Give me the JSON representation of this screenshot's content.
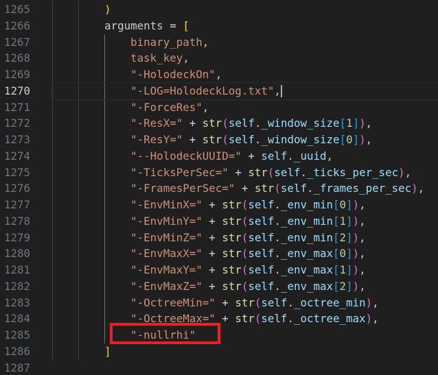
{
  "editor": {
    "lines": [
      {
        "number": "1265",
        "indent": 2,
        "tokens": [
          {
            "t": ")",
            "c": "b1"
          }
        ]
      },
      {
        "number": "1266",
        "indent": 2,
        "tokens": [
          {
            "t": "arguments",
            "c": "ident"
          },
          {
            "t": " = ",
            "c": "op"
          },
          {
            "t": "[",
            "c": "b1"
          }
        ]
      },
      {
        "number": "1267",
        "indent": 3,
        "tokens": [
          {
            "t": "binary_path",
            "c": "string"
          },
          {
            "t": ",",
            "c": "punct"
          }
        ]
      },
      {
        "number": "1268",
        "indent": 3,
        "tokens": [
          {
            "t": "task_key",
            "c": "string"
          },
          {
            "t": ",",
            "c": "punct"
          }
        ]
      },
      {
        "number": "1269",
        "indent": 3,
        "tokens": [
          {
            "t": "\"-HolodeckOn\"",
            "c": "string"
          },
          {
            "t": ",",
            "c": "punct"
          }
        ]
      },
      {
        "number": "1270",
        "indent": 3,
        "current": true,
        "tokens": [
          {
            "t": "\"-LOG=HolodeckLog.txt\"",
            "c": "string"
          },
          {
            "t": ",",
            "c": "punct"
          },
          {
            "t": "",
            "c": "cursor"
          }
        ]
      },
      {
        "number": "1271",
        "indent": 3,
        "tokens": [
          {
            "t": "\"-ForceRes\"",
            "c": "string"
          },
          {
            "t": ",",
            "c": "punct"
          }
        ]
      },
      {
        "number": "1272",
        "indent": 3,
        "tokens": [
          {
            "t": "\"-ResX=\"",
            "c": "string"
          },
          {
            "t": " + ",
            "c": "op"
          },
          {
            "t": "str",
            "c": "builtin"
          },
          {
            "t": "(",
            "c": "b2"
          },
          {
            "t": "self",
            "c": "var"
          },
          {
            "t": ".",
            "c": "punct"
          },
          {
            "t": "_window_size",
            "c": "var"
          },
          {
            "t": "[",
            "c": "b3"
          },
          {
            "t": "1",
            "c": "num"
          },
          {
            "t": "]",
            "c": "b3"
          },
          {
            "t": ")",
            "c": "b2"
          },
          {
            "t": ",",
            "c": "punct"
          }
        ]
      },
      {
        "number": "1273",
        "indent": 3,
        "tokens": [
          {
            "t": "\"-ResY=\"",
            "c": "string"
          },
          {
            "t": " + ",
            "c": "op"
          },
          {
            "t": "str",
            "c": "builtin"
          },
          {
            "t": "(",
            "c": "b2"
          },
          {
            "t": "self",
            "c": "var"
          },
          {
            "t": ".",
            "c": "punct"
          },
          {
            "t": "_window_size",
            "c": "var"
          },
          {
            "t": "[",
            "c": "b3"
          },
          {
            "t": "0",
            "c": "num"
          },
          {
            "t": "]",
            "c": "b3"
          },
          {
            "t": ")",
            "c": "b2"
          },
          {
            "t": ",",
            "c": "punct"
          }
        ]
      },
      {
        "number": "1274",
        "indent": 3,
        "tokens": [
          {
            "t": "\"--HolodeckUUID=\"",
            "c": "string"
          },
          {
            "t": " + ",
            "c": "op"
          },
          {
            "t": "self",
            "c": "var"
          },
          {
            "t": ".",
            "c": "punct"
          },
          {
            "t": "_uuid",
            "c": "var"
          },
          {
            "t": ",",
            "c": "punct"
          }
        ]
      },
      {
        "number": "1275",
        "indent": 3,
        "tokens": [
          {
            "t": "\"-TicksPerSec=\"",
            "c": "string"
          },
          {
            "t": " + ",
            "c": "op"
          },
          {
            "t": "str",
            "c": "builtin"
          },
          {
            "t": "(",
            "c": "b2"
          },
          {
            "t": "self",
            "c": "var"
          },
          {
            "t": ".",
            "c": "punct"
          },
          {
            "t": "_ticks_per_sec",
            "c": "var"
          },
          {
            "t": ")",
            "c": "b2"
          },
          {
            "t": ",",
            "c": "punct"
          }
        ]
      },
      {
        "number": "1276",
        "indent": 3,
        "tokens": [
          {
            "t": "\"-FramesPerSec=\"",
            "c": "string"
          },
          {
            "t": " + ",
            "c": "op"
          },
          {
            "t": "str",
            "c": "builtin"
          },
          {
            "t": "(",
            "c": "b2"
          },
          {
            "t": "self",
            "c": "var"
          },
          {
            "t": ".",
            "c": "punct"
          },
          {
            "t": "_frames_per_sec",
            "c": "var"
          },
          {
            "t": ")",
            "c": "b2"
          },
          {
            "t": ",",
            "c": "punct"
          }
        ]
      },
      {
        "number": "1277",
        "indent": 3,
        "tokens": [
          {
            "t": "\"-EnvMinX=\"",
            "c": "string"
          },
          {
            "t": " + ",
            "c": "op"
          },
          {
            "t": "str",
            "c": "builtin"
          },
          {
            "t": "(",
            "c": "b2"
          },
          {
            "t": "self",
            "c": "var"
          },
          {
            "t": ".",
            "c": "punct"
          },
          {
            "t": "_env_min",
            "c": "var"
          },
          {
            "t": "[",
            "c": "b3"
          },
          {
            "t": "0",
            "c": "num"
          },
          {
            "t": "]",
            "c": "b3"
          },
          {
            "t": ")",
            "c": "b2"
          },
          {
            "t": ",",
            "c": "punct"
          }
        ]
      },
      {
        "number": "1278",
        "indent": 3,
        "tokens": [
          {
            "t": "\"-EnvMinY=\"",
            "c": "string"
          },
          {
            "t": " + ",
            "c": "op"
          },
          {
            "t": "str",
            "c": "builtin"
          },
          {
            "t": "(",
            "c": "b2"
          },
          {
            "t": "self",
            "c": "var"
          },
          {
            "t": ".",
            "c": "punct"
          },
          {
            "t": "_env_min",
            "c": "var"
          },
          {
            "t": "[",
            "c": "b3"
          },
          {
            "t": "1",
            "c": "num"
          },
          {
            "t": "]",
            "c": "b3"
          },
          {
            "t": ")",
            "c": "b2"
          },
          {
            "t": ",",
            "c": "punct"
          }
        ]
      },
      {
        "number": "1279",
        "indent": 3,
        "tokens": [
          {
            "t": "\"-EnvMinZ=\"",
            "c": "string"
          },
          {
            "t": " + ",
            "c": "op"
          },
          {
            "t": "str",
            "c": "builtin"
          },
          {
            "t": "(",
            "c": "b2"
          },
          {
            "t": "self",
            "c": "var"
          },
          {
            "t": ".",
            "c": "punct"
          },
          {
            "t": "_env_min",
            "c": "var"
          },
          {
            "t": "[",
            "c": "b3"
          },
          {
            "t": "2",
            "c": "num"
          },
          {
            "t": "]",
            "c": "b3"
          },
          {
            "t": ")",
            "c": "b2"
          },
          {
            "t": ",",
            "c": "punct"
          }
        ]
      },
      {
        "number": "1280",
        "indent": 3,
        "tokens": [
          {
            "t": "\"-EnvMaxX=\"",
            "c": "string"
          },
          {
            "t": " + ",
            "c": "op"
          },
          {
            "t": "str",
            "c": "builtin"
          },
          {
            "t": "(",
            "c": "b2"
          },
          {
            "t": "self",
            "c": "var"
          },
          {
            "t": ".",
            "c": "punct"
          },
          {
            "t": "_env_max",
            "c": "var"
          },
          {
            "t": "[",
            "c": "b3"
          },
          {
            "t": "0",
            "c": "num"
          },
          {
            "t": "]",
            "c": "b3"
          },
          {
            "t": ")",
            "c": "b2"
          },
          {
            "t": ",",
            "c": "punct"
          }
        ]
      },
      {
        "number": "1281",
        "indent": 3,
        "tokens": [
          {
            "t": "\"-EnvMaxY=\"",
            "c": "string"
          },
          {
            "t": " + ",
            "c": "op"
          },
          {
            "t": "str",
            "c": "builtin"
          },
          {
            "t": "(",
            "c": "b2"
          },
          {
            "t": "self",
            "c": "var"
          },
          {
            "t": ".",
            "c": "punct"
          },
          {
            "t": "_env_max",
            "c": "var"
          },
          {
            "t": "[",
            "c": "b3"
          },
          {
            "t": "1",
            "c": "num"
          },
          {
            "t": "]",
            "c": "b3"
          },
          {
            "t": ")",
            "c": "b2"
          },
          {
            "t": ",",
            "c": "punct"
          }
        ]
      },
      {
        "number": "1282",
        "indent": 3,
        "tokens": [
          {
            "t": "\"-EnvMaxZ=\"",
            "c": "string"
          },
          {
            "t": " + ",
            "c": "op"
          },
          {
            "t": "str",
            "c": "builtin"
          },
          {
            "t": "(",
            "c": "b2"
          },
          {
            "t": "self",
            "c": "var"
          },
          {
            "t": ".",
            "c": "punct"
          },
          {
            "t": "_env_max",
            "c": "var"
          },
          {
            "t": "[",
            "c": "b3"
          },
          {
            "t": "2",
            "c": "num"
          },
          {
            "t": "]",
            "c": "b3"
          },
          {
            "t": ")",
            "c": "b2"
          },
          {
            "t": ",",
            "c": "punct"
          }
        ]
      },
      {
        "number": "1283",
        "indent": 3,
        "tokens": [
          {
            "t": "\"-OctreeMin=\"",
            "c": "string"
          },
          {
            "t": " + ",
            "c": "op"
          },
          {
            "t": "str",
            "c": "builtin"
          },
          {
            "t": "(",
            "c": "b2"
          },
          {
            "t": "self",
            "c": "var"
          },
          {
            "t": ".",
            "c": "punct"
          },
          {
            "t": "_octree_min",
            "c": "var"
          },
          {
            "t": ")",
            "c": "b2"
          },
          {
            "t": ",",
            "c": "punct"
          }
        ]
      },
      {
        "number": "1284",
        "indent": 3,
        "tokens": [
          {
            "t": "\"-OctreeMax=\"",
            "c": "string"
          },
          {
            "t": " + ",
            "c": "op"
          },
          {
            "t": "str",
            "c": "builtin"
          },
          {
            "t": "(",
            "c": "b2"
          },
          {
            "t": "self",
            "c": "var"
          },
          {
            "t": ".",
            "c": "punct"
          },
          {
            "t": "_octree_max",
            "c": "var"
          },
          {
            "t": ")",
            "c": "b2"
          },
          {
            "t": ",",
            "c": "punct"
          }
        ]
      },
      {
        "number": "1285",
        "indent": 3,
        "highlighted": true,
        "tokens": [
          {
            "t": "\"-nullrhi\"",
            "c": "string"
          }
        ]
      },
      {
        "number": "1286",
        "indent": 2,
        "tokens": [
          {
            "t": "]",
            "c": "b1"
          }
        ]
      },
      {
        "number": "1287",
        "indent": 0,
        "tokens": []
      }
    ]
  },
  "colors": {
    "background": "#1f1f1f",
    "line_number": "#6e7681",
    "string": "#ce9178",
    "builtin": "#dcdcaa",
    "variable": "#9cdcfe",
    "bracket_level_1": "#ffd700",
    "bracket_level_2": "#da70d6",
    "bracket_level_3": "#179fff",
    "highlight_box": "#e8202a"
  }
}
